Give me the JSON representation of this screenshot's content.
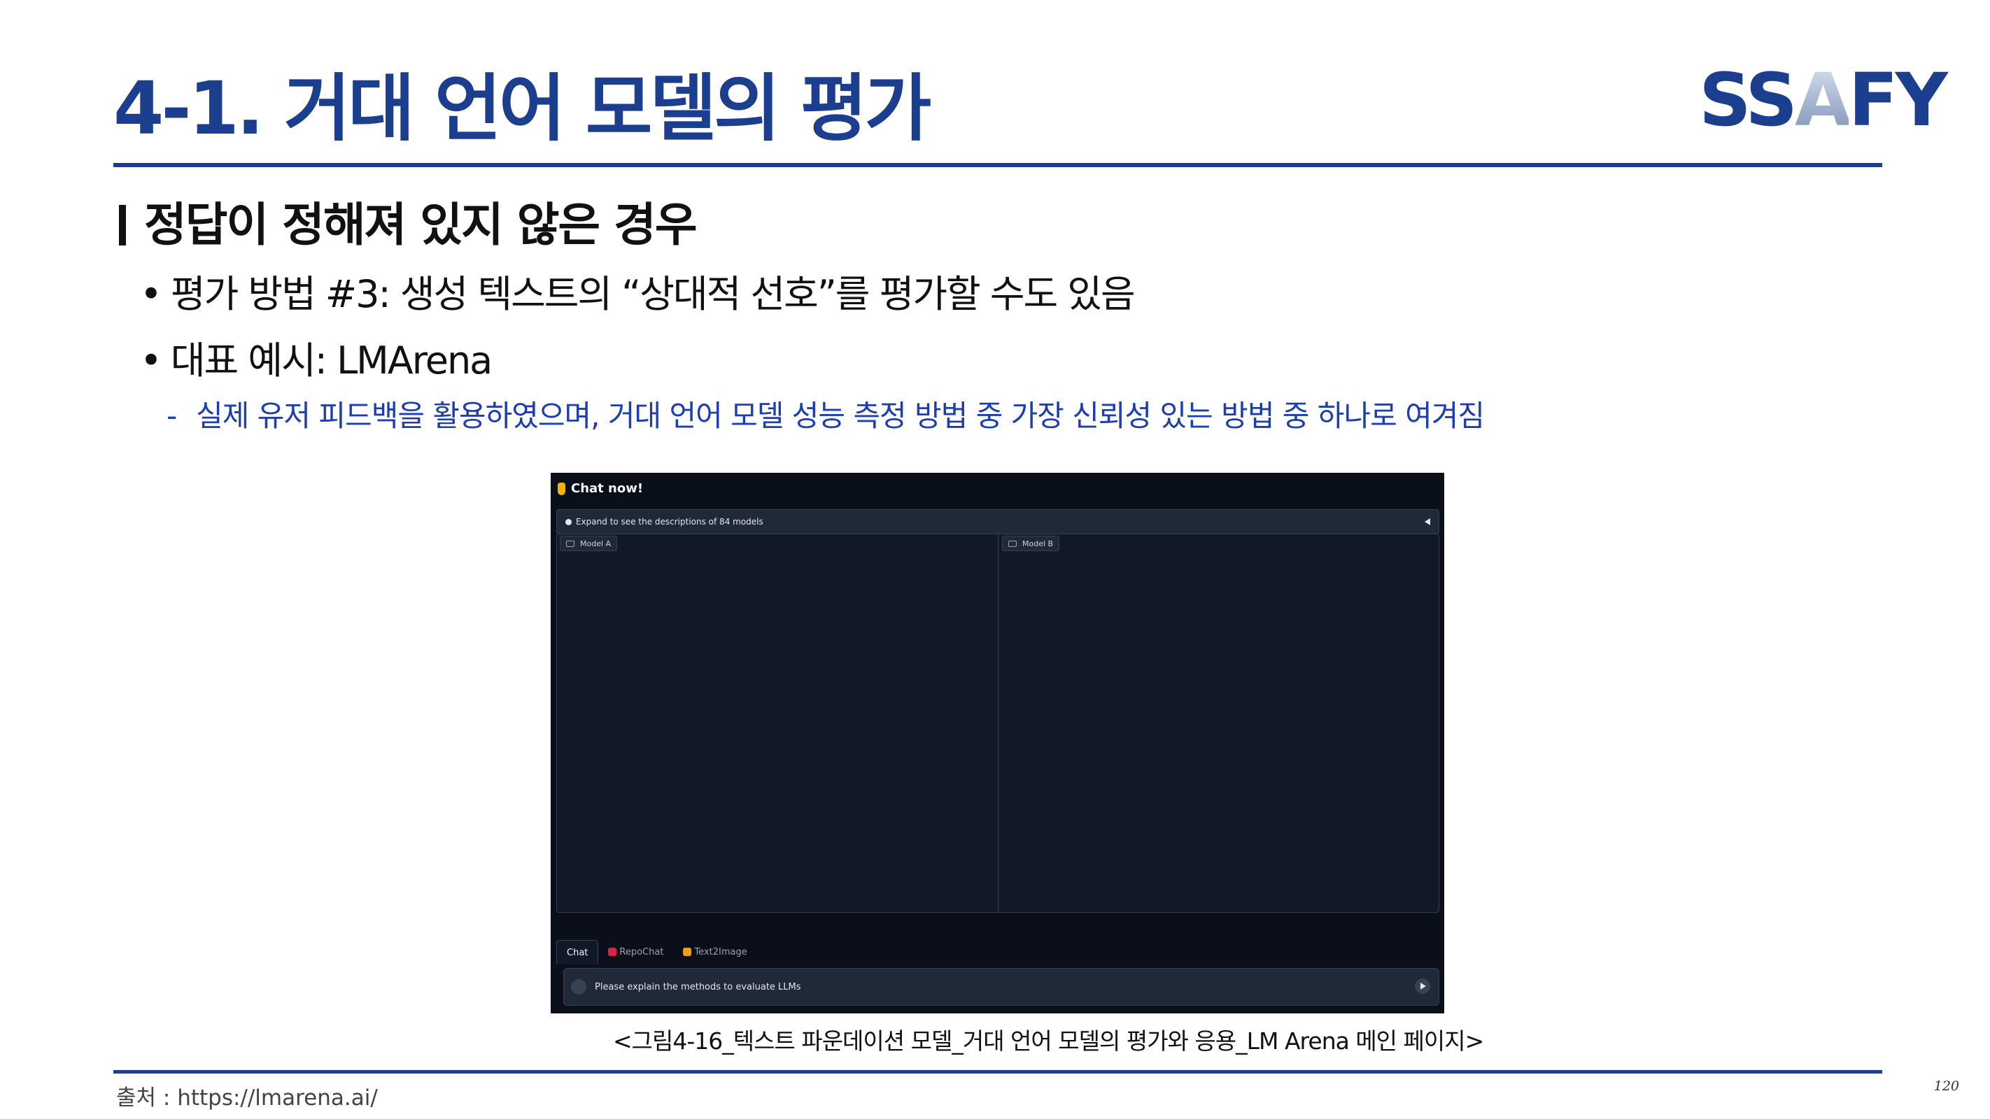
{
  "slide": {
    "title": "4-1. 거대 언어 모델의 평가",
    "logo": {
      "part1": "SS",
      "part2": "A",
      "part3": "FY"
    },
    "section_heading": "정답이 정해져 있지 않은 경우",
    "bullets": [
      "평가 방법 #3: 생성 텍스트의 “상대적 선호”를 평가할 수도 있음",
      "대표 예시: LMArena"
    ],
    "bullet_marker": "•",
    "sub_bullet": "실제 유저 피드백을 활용하였으며, 거대 언어 모델 성능 측정 방법 중 가장 신뢰성 있는 방법 중 하나로 여겨짐",
    "sub_bullet_marker": "-",
    "caption": "<그림4-16_텍스트 파운데이션 모델_거대 언어 모델의 평가와 응용_LM Arena 메인 페이지>",
    "source": "출처 : https://lmarena.ai/",
    "page_number": "120"
  },
  "screenshot": {
    "header": "Chat now!",
    "accordion_text": "Expand to see the descriptions of 84 models",
    "model_a_label": "Model A",
    "model_b_label": "Model B",
    "tabs": [
      {
        "label": "Chat",
        "active": true
      },
      {
        "label": "RepoChat",
        "active": false
      },
      {
        "label": "Text2Image",
        "active": false
      }
    ],
    "input_text": "Please explain the methods to evaluate LLMs",
    "icons": [
      "hand-pointing-down-icon",
      "lightbulb-icon",
      "collapse-triangle-icon",
      "chatbot-icon",
      "attach-icon",
      "send-icon"
    ]
  },
  "colors": {
    "brand": "#1c3e8f",
    "sub_bullet": "#1c3eb0",
    "screenshot_bg": "#0b0f19",
    "panel_bg": "#111827"
  }
}
